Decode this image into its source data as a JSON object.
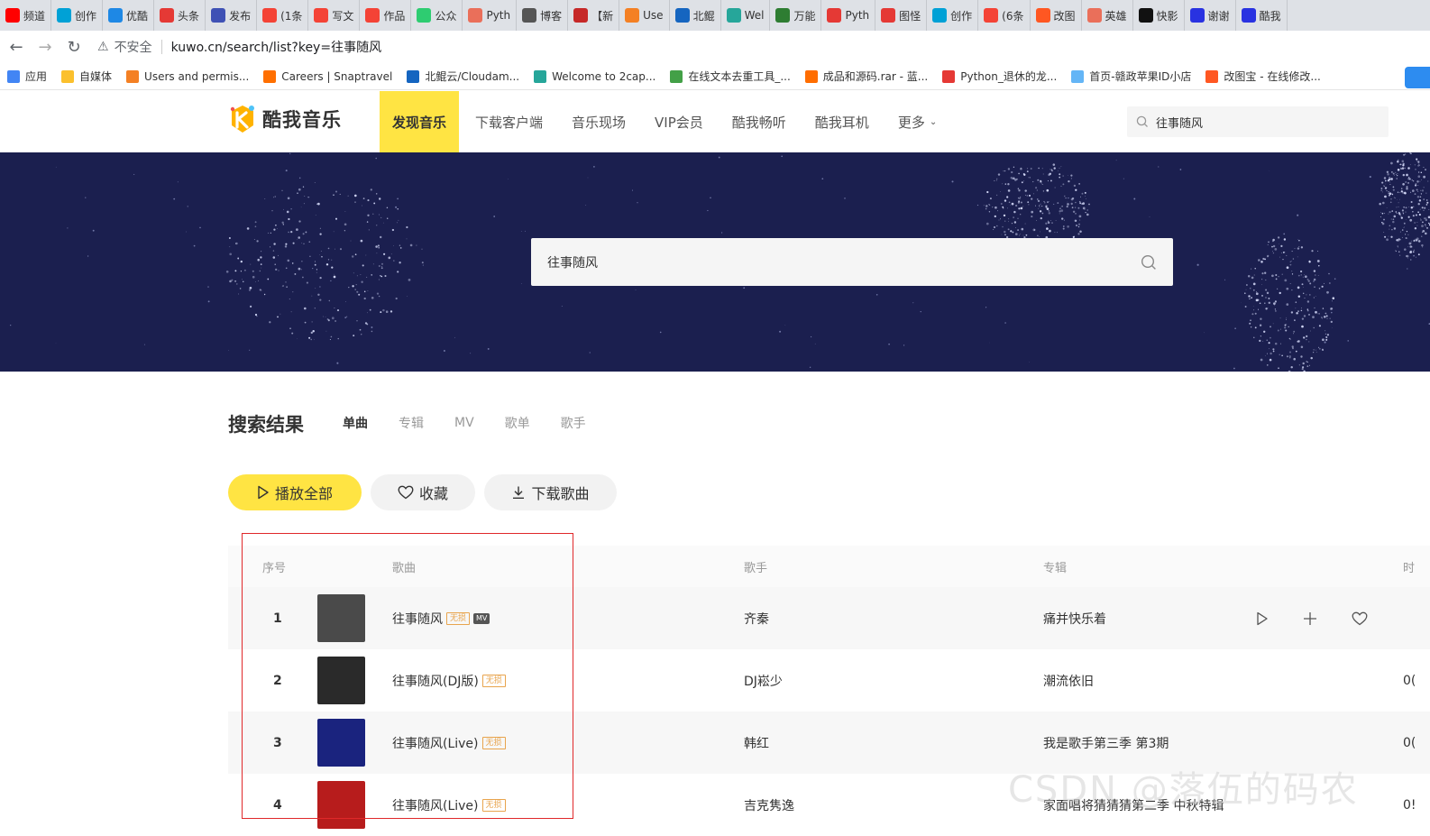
{
  "browser": {
    "tabs": [
      {
        "label": "频道",
        "icon": "youtube-icon",
        "color": "#ff0000"
      },
      {
        "label": "创作",
        "icon": "bilibili-icon",
        "color": "#00a1d6"
      },
      {
        "label": "优酷",
        "icon": "youku-icon",
        "color": "#1e88e5"
      },
      {
        "label": "头条",
        "icon": "toutiao-icon",
        "color": "#e53935"
      },
      {
        "label": "发布",
        "icon": "publish-icon",
        "color": "#3f51b5"
      },
      {
        "label": "(1条",
        "icon": "csdn-icon",
        "color": "#f44336"
      },
      {
        "label": "写文",
        "icon": "csdn-icon",
        "color": "#f44336"
      },
      {
        "label": "作品",
        "icon": "csdn-icon",
        "color": "#f44336"
      },
      {
        "label": "公众",
        "icon": "wechat-icon",
        "color": "#2ecc71"
      },
      {
        "label": "Pyth",
        "icon": "jianshu-icon",
        "color": "#ea6f5a"
      },
      {
        "label": "博客",
        "icon": "blog-icon",
        "color": "#555555"
      },
      {
        "label": "【新",
        "icon": "news-icon",
        "color": "#c62828"
      },
      {
        "label": "Use",
        "icon": "stackoverflow-icon",
        "color": "#f48024"
      },
      {
        "label": "北鲲",
        "icon": "cloud-icon",
        "color": "#1565c0"
      },
      {
        "label": "Wel",
        "icon": "2captcha-icon",
        "color": "#26a69a"
      },
      {
        "label": "万能",
        "icon": "w-icon",
        "color": "#2e7d32"
      },
      {
        "label": "Pyth",
        "icon": "image-icon",
        "color": "#e53935"
      },
      {
        "label": "图怪",
        "icon": "image-icon",
        "color": "#e53935"
      },
      {
        "label": "创作",
        "icon": "bilibili-icon",
        "color": "#00a1d6"
      },
      {
        "label": "(6条",
        "icon": "csdn-icon",
        "color": "#f44336"
      },
      {
        "label": "改图",
        "icon": "office-icon",
        "color": "#ff5722"
      },
      {
        "label": "英雄",
        "icon": "jianshu-icon",
        "color": "#ea6f5a"
      },
      {
        "label": "快影",
        "icon": "kuaiying-icon",
        "color": "#111111"
      },
      {
        "label": "谢谢",
        "icon": "baidu-icon",
        "color": "#2932e1"
      },
      {
        "label": "酷我",
        "icon": "baidu-icon",
        "color": "#2932e1"
      }
    ],
    "insecure_label": "不安全",
    "url": "kuwo.cn/search/list?key=往事随风",
    "bookmarks": [
      {
        "label": "应用",
        "color": "#4285f4"
      },
      {
        "label": "自媒体",
        "color": "#fbc02d"
      },
      {
        "label": "Users and permis...",
        "color": "#f48024"
      },
      {
        "label": "Careers | Snaptravel",
        "color": "#ff6f00"
      },
      {
        "label": "北鲲云/Cloudam...",
        "color": "#1565c0"
      },
      {
        "label": "Welcome to 2cap...",
        "color": "#26a69a"
      },
      {
        "label": "在线文本去重工具_...",
        "color": "#43a047"
      },
      {
        "label": "成品和源码.rar - 蓝...",
        "color": "#ff6d00"
      },
      {
        "label": "Python_退休的龙...",
        "color": "#e53935"
      },
      {
        "label": "首页-赣政苹果ID小店",
        "color": "#64b5f6"
      },
      {
        "label": "改图宝 - 在线修改...",
        "color": "#ff5722"
      }
    ]
  },
  "site": {
    "logo_text": "酷我音乐",
    "nav": [
      "发现音乐",
      "下载客户端",
      "音乐现场",
      "VIP会员",
      "酷我畅听",
      "酷我耳机",
      "更多"
    ],
    "header_search": "往事随风",
    "banner_search": "往事随风"
  },
  "results": {
    "title": "搜索结果",
    "tabs": [
      "单曲",
      "专辑",
      "MV",
      "歌单",
      "歌手"
    ],
    "actions": {
      "play_all": "播放全部",
      "collect": "收藏",
      "download": "下载歌曲"
    },
    "columns": {
      "index": "序号",
      "song": "歌曲",
      "artist": "歌手",
      "album": "专辑",
      "time": "时"
    },
    "lossless_badge": "无损",
    "mv_badge": "MV",
    "rows": [
      {
        "index": "1",
        "song": "往事随风",
        "artist": "齐秦",
        "album": "痛并快乐着",
        "time": "",
        "mv": true,
        "cover_color": "#4a4a4a"
      },
      {
        "index": "2",
        "song": "往事随风(DJ版)",
        "artist": "DJ崧少",
        "album": "潮流依旧",
        "time": "0(",
        "mv": false,
        "cover_color": "#2a2a2a"
      },
      {
        "index": "3",
        "song": "往事随风(Live)",
        "artist": "韩红",
        "album": "我是歌手第三季 第3期",
        "time": "0(",
        "mv": false,
        "cover_color": "#1a237e"
      },
      {
        "index": "4",
        "song": "往事随风(Live)",
        "artist": "吉克隽逸",
        "album": "家面唱将猜猜猜第二季 中秋特辑",
        "time": "0!",
        "mv": false,
        "cover_color": "#b71c1c"
      }
    ]
  },
  "watermark": "CSDN @落伍的码农"
}
